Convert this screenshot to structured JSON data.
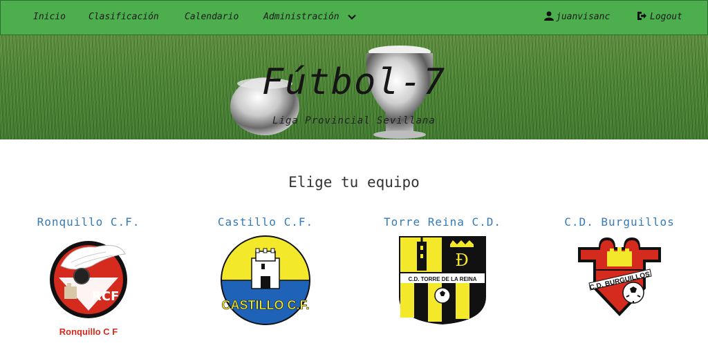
{
  "navbar": {
    "items": [
      {
        "label": "Inicio"
      },
      {
        "label": "Clasificación"
      },
      {
        "label": "Calendario"
      },
      {
        "label": "Administración"
      }
    ],
    "user": "juanvisanc",
    "logout": "Logout",
    "bg_color": "#4cae4c"
  },
  "hero": {
    "title": "Fútbol-7",
    "subtitle": "Liga Provincial Sevillana"
  },
  "main": {
    "heading": "Elige tu equipo",
    "teams": [
      {
        "name": "Ronquillo C.F.",
        "logo_text": "RCF",
        "caption": "Ronquillo C F"
      },
      {
        "name": "Castillo C.F.",
        "logo_text": "CASTILLO C.F."
      },
      {
        "name": "Torre Reina C.D.",
        "logo_text": "C.D. TORRE DE LA REINA"
      },
      {
        "name": "C.D. Burguillos",
        "logo_text": "C.D. BURGUILLOS"
      }
    ],
    "link_color": "#337ab7"
  }
}
